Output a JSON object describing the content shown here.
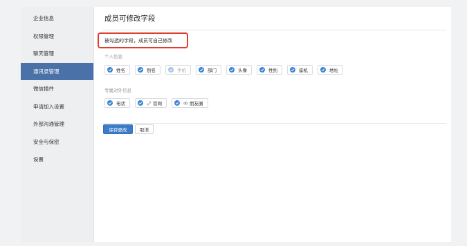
{
  "sidebar": {
    "items": [
      {
        "label": "企业信息"
      },
      {
        "label": "权限管理"
      },
      {
        "label": "聊天管理"
      },
      {
        "label": "通讯录管理"
      },
      {
        "label": "微信插件"
      },
      {
        "label": "申请加入设置"
      },
      {
        "label": "外部沟通管理"
      },
      {
        "label": "安全与保密"
      },
      {
        "label": "设置"
      }
    ],
    "active_index": 3
  },
  "main": {
    "title": "成员可修改字段",
    "hint": "被勾选的字段，成员可自己修改",
    "personal": {
      "label": "个人信息",
      "fields": [
        {
          "label": "姓名",
          "checked": true
        },
        {
          "label": "别名",
          "checked": true
        },
        {
          "label": "手机",
          "checked": true,
          "disabled": true
        },
        {
          "label": "部门",
          "checked": true
        },
        {
          "label": "头像",
          "checked": true
        },
        {
          "label": "性别",
          "checked": true
        },
        {
          "label": "座机",
          "checked": true
        },
        {
          "label": "地址",
          "checked": true
        }
      ]
    },
    "external": {
      "label": "专属对外信息",
      "fields": [
        {
          "label": "电话",
          "checked": true
        },
        {
          "label": "官网",
          "checked": true,
          "icon": "link-icon"
        },
        {
          "label": "朋友圈",
          "checked": true,
          "icon": "moments-icon"
        }
      ]
    },
    "save_label": "保存更改",
    "cancel_label": "取消"
  },
  "colors": {
    "accent": "#3d7cc6",
    "sidebar_active": "#4a72a8",
    "highlight_border": "#e03d2f"
  }
}
